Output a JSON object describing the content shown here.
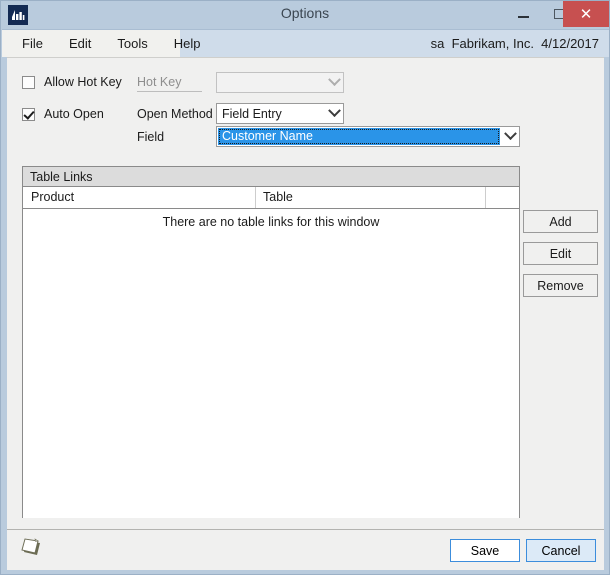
{
  "window": {
    "title": "Options",
    "app_icon": "dynamics-gp-icon",
    "controls": {
      "minimize": "minimize-icon",
      "maximize": "maximize-icon",
      "close": "close-icon"
    }
  },
  "menubar": {
    "items": [
      {
        "label": "File"
      },
      {
        "label": "Edit"
      },
      {
        "label": "Tools"
      },
      {
        "label": "Help"
      }
    ],
    "status": "sa  Fabrikam, Inc.  4/12/2017"
  },
  "form": {
    "allow_hot_key": {
      "label": "Allow Hot Key",
      "checked": false
    },
    "auto_open": {
      "label": "Auto Open",
      "checked": true
    },
    "hot_key": {
      "label": "Hot Key",
      "value": "",
      "disabled": true
    },
    "open_method": {
      "label": "Open Method",
      "value": "Field Entry"
    },
    "field": {
      "label": "Field",
      "value": "Customer Name",
      "selected": true
    }
  },
  "table_links": {
    "title": "Table Links",
    "columns": [
      "Product",
      "Table"
    ],
    "rows": [],
    "empty_message": "There are no table links for this window"
  },
  "side_buttons": [
    {
      "label": "Add"
    },
    {
      "label": "Edit"
    },
    {
      "label": "Remove"
    }
  ],
  "footer": {
    "note_icon": "note-icon",
    "save_label": "Save",
    "cancel_label": "Cancel"
  },
  "colors": {
    "titlebar": "#b9cbdd",
    "close_button": "#c75050",
    "menubar": "#cfdcea",
    "body": "#f0f0ef",
    "selection": "#2a94e8",
    "panel_header": "#dcdcdc",
    "focus_border": "#3c8ddc"
  }
}
